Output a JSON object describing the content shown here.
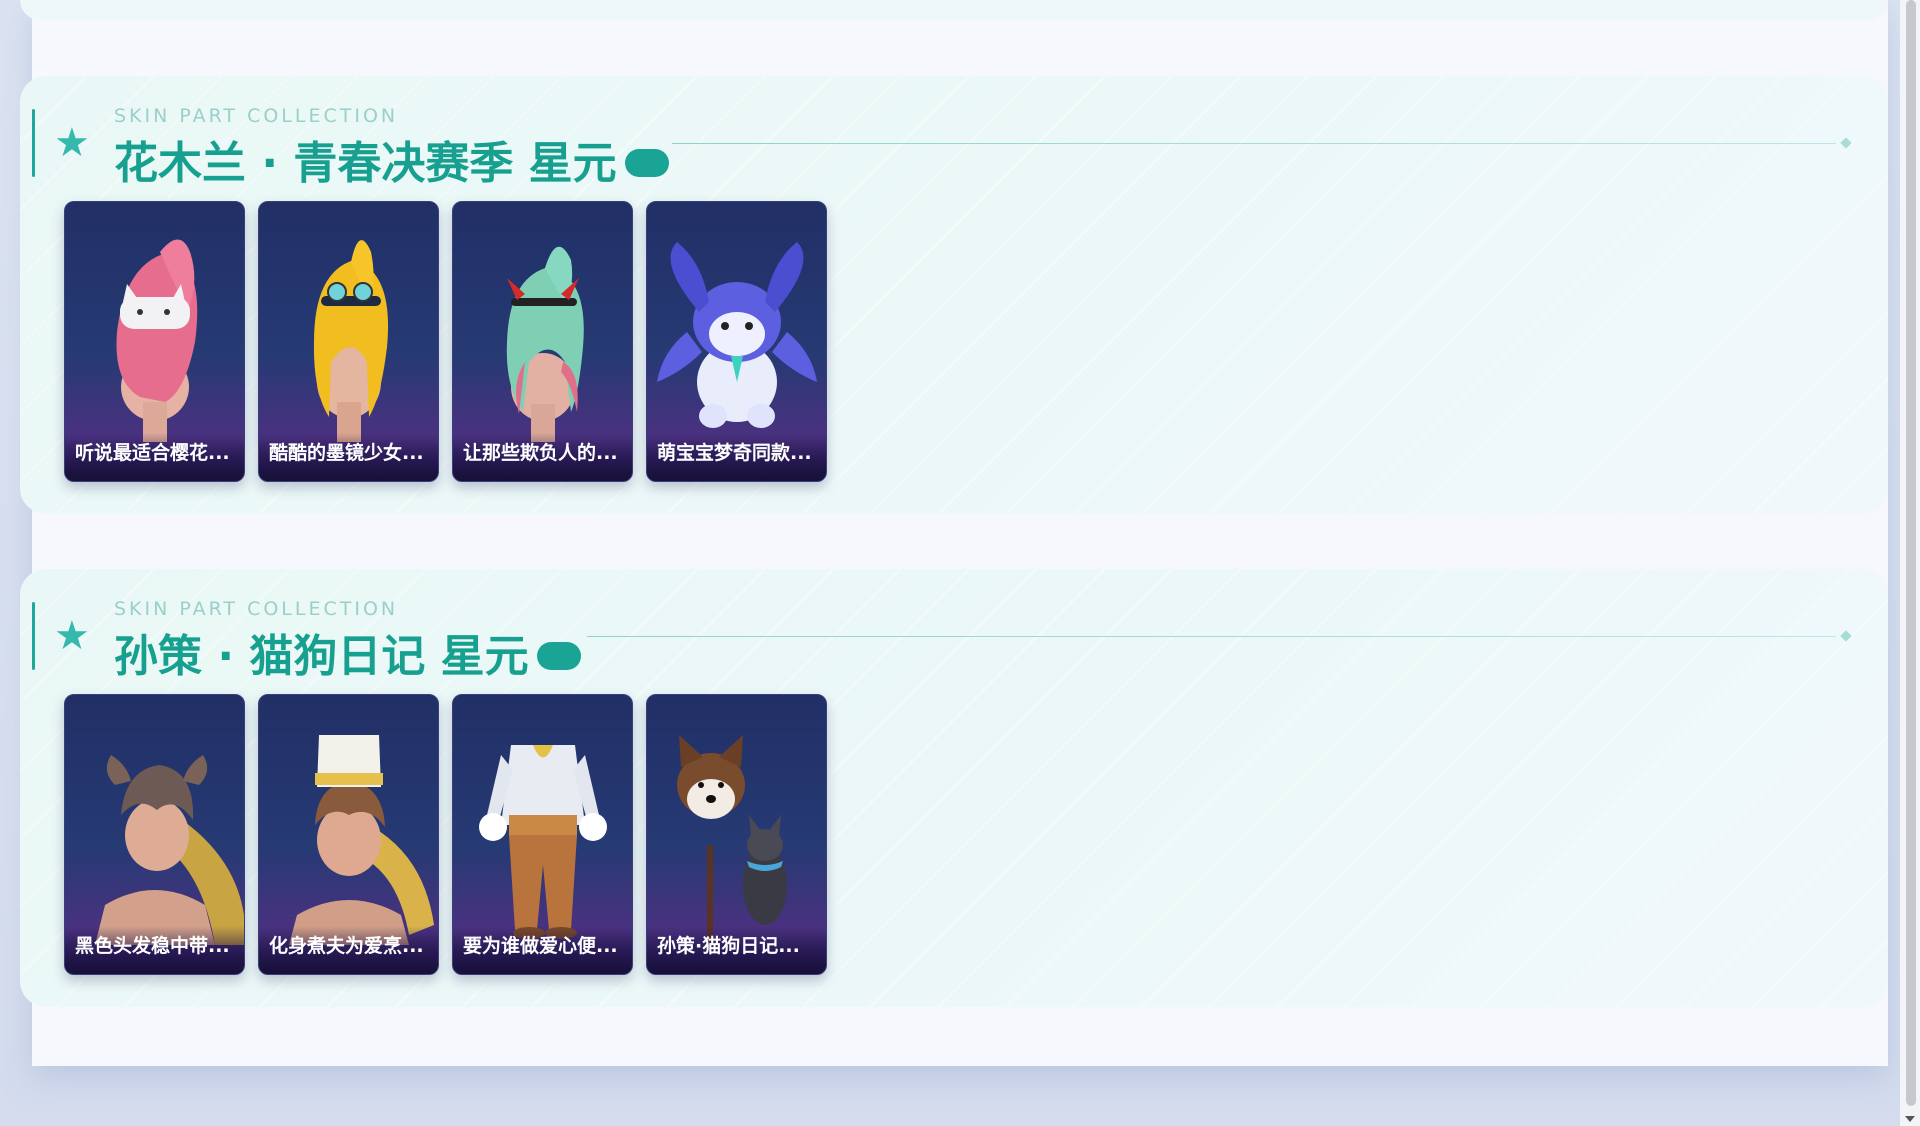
{
  "sections": [
    {
      "eyebrow": "SKIN PART COLLECTION",
      "title": "花木兰 · 青春决赛季 星元",
      "items": [
        {
          "label": "听说最适合樱花...",
          "icon": "pink-hair-cat-hat-icon"
        },
        {
          "label": "酷酷的墨镜少女...",
          "icon": "blonde-hair-sunglasses-icon"
        },
        {
          "label": "让那些欺负人的...",
          "icon": "mint-hair-devil-horns-icon"
        },
        {
          "label": "萌宝宝梦奇同款...",
          "icon": "blue-plush-mascot-icon"
        }
      ]
    },
    {
      "eyebrow": "SKIN PART COLLECTION",
      "title": "孙策 · 猫狗日记 星元",
      "items": [
        {
          "label": "黑色头发稳中带...",
          "icon": "dark-hair-dog-ears-icon"
        },
        {
          "label": "化身煮夫为爱烹...",
          "icon": "chef-hat-hero-icon"
        },
        {
          "label": "要为谁做爱心便...",
          "icon": "chef-outfit-body-icon"
        },
        {
          "label": "孙策·猫狗日记...",
          "icon": "shiba-dog-cat-icon"
        }
      ]
    }
  ],
  "colors": {
    "accent": "#17a090",
    "card_bg": "#263a74",
    "eyebrow": "#9bcfcb"
  }
}
